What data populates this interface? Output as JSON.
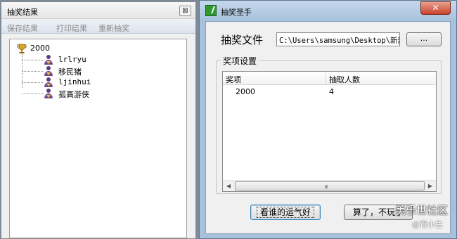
{
  "results_window": {
    "title": "抽奖结果",
    "close_label": "⊠",
    "menu": [
      "保存结果",
      "打印结果",
      "重新抽奖"
    ],
    "tree": {
      "root": "2000",
      "items": [
        "lrlryu",
        "移民猪",
        "ljinhui",
        "孤高游侠"
      ]
    }
  },
  "main_window": {
    "title": "抽奖圣手",
    "close_label": "✕",
    "file_label": "抽奖文件",
    "file_path": "C:\\Users\\samsung\\Desktop\\新建",
    "browse_label": "...",
    "group_title": "奖项设置",
    "list": {
      "headers": [
        "奖项",
        "抽取人数"
      ],
      "rows": [
        {
          "prize": "2000",
          "count": "4"
        }
      ]
    },
    "scroll_grip": "III",
    "draw_button": "看谁的运气好",
    "quit_button": "算了，不玩了"
  },
  "watermark": {
    "line1": "美乐世社区",
    "line2": "@百小生"
  },
  "colors": {
    "desktop": "#7c8a9a",
    "title_blue": "#a7c1dc",
    "close_red": "#c8442b",
    "disabled_text": "#8a8a8a"
  }
}
